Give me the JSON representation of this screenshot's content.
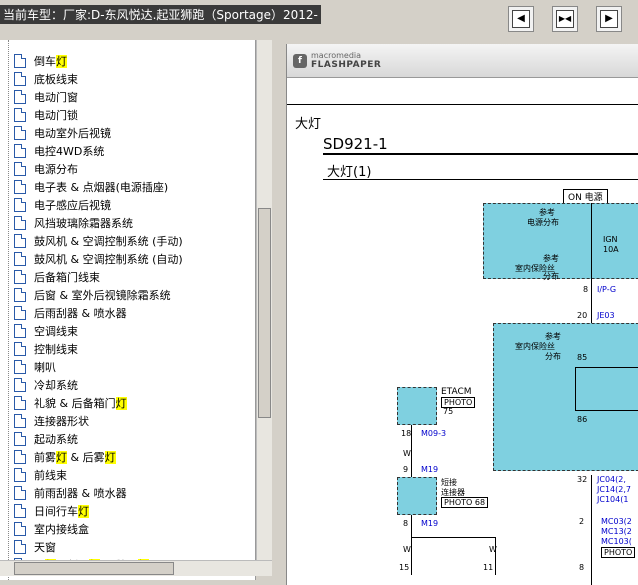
{
  "window": {
    "title": "当前车型：厂家:D-东风悦达.起亚狮跑（Sportage）2012-",
    "buttons": [
      {
        "name": "nav-left-button",
        "glyph": "◀"
      },
      {
        "name": "nav-split-button",
        "glyph": "▶◀"
      },
      {
        "name": "nav-right-button",
        "glyph": "▶"
      }
    ]
  },
  "tree": {
    "items": [
      {
        "pre": "倒车",
        "hl": "灯",
        "post": ""
      },
      {
        "pre": "底板线束",
        "hl": "",
        "post": ""
      },
      {
        "pre": "电动门窗",
        "hl": "",
        "post": ""
      },
      {
        "pre": "电动门锁",
        "hl": "",
        "post": ""
      },
      {
        "pre": "电动室外后视镜",
        "hl": "",
        "post": ""
      },
      {
        "pre": "电控4WD系统",
        "hl": "",
        "post": ""
      },
      {
        "pre": "电源分布",
        "hl": "",
        "post": ""
      },
      {
        "pre": "电子表 & 点烟器(电源插座)",
        "hl": "",
        "post": ""
      },
      {
        "pre": "电子感应后视镜",
        "hl": "",
        "post": ""
      },
      {
        "pre": "风挡玻璃除霜器系统",
        "hl": "",
        "post": ""
      },
      {
        "pre": "鼓风机 & 空调控制系统 (手动)",
        "hl": "",
        "post": ""
      },
      {
        "pre": "鼓风机 & 空调控制系统 (自动)",
        "hl": "",
        "post": ""
      },
      {
        "pre": "后备箱门线束",
        "hl": "",
        "post": ""
      },
      {
        "pre": "后窗 & 室外后视镜除霜系统",
        "hl": "",
        "post": ""
      },
      {
        "pre": "后雨刮器 & 喷水器",
        "hl": "",
        "post": ""
      },
      {
        "pre": "空调线束",
        "hl": "",
        "post": ""
      },
      {
        "pre": "控制线束",
        "hl": "",
        "post": ""
      },
      {
        "pre": "喇叭",
        "hl": "",
        "post": ""
      },
      {
        "pre": "冷却系统",
        "hl": "",
        "post": ""
      },
      {
        "pre": "礼貌 & 后备箱门",
        "hl": "灯",
        "post": ""
      },
      {
        "pre": "连接器形状",
        "hl": "",
        "post": ""
      },
      {
        "pre": "起动系统",
        "hl": "",
        "post": ""
      },
      {
        "pre": "前雾",
        "hl": "灯",
        "post": " & 后雾",
        "hl2": "灯"
      },
      {
        "pre": "前线束",
        "hl": "",
        "post": ""
      },
      {
        "pre": "前雨刮器 & 喷水器",
        "hl": "",
        "post": ""
      },
      {
        "pre": "日间行车",
        "hl": "灯",
        "post": ""
      },
      {
        "pre": "室内接线盒",
        "hl": "",
        "post": ""
      },
      {
        "pre": "天窗",
        "hl": "",
        "post": ""
      },
      {
        "pre": "尾",
        "hl": "灯",
        "post": "，制动",
        "hl2": "灯",
        "post2": " & 牌照",
        "hl3": "灯"
      }
    ]
  },
  "viewer": {
    "logo_top": "macromedia",
    "logo_bottom": "FLASHPAPER",
    "doc_heading": "大灯",
    "section_code": "SD921-1",
    "section_title": "大灯(1)",
    "on_label": "ON 电源",
    "ref1_a": "参考",
    "ref1_b": "电源分布",
    "ign": "IGN",
    "amp": "10A",
    "ref2_a": "参考",
    "ref2_b": "室内保险丝",
    "ref2_c": "分布",
    "pin8": "8",
    "ip_g": "I/P-G",
    "pin20": "20",
    "je03": "JE03",
    "ref3_a": "参考",
    "ref3_b": "室内保险丝",
    "ref3_c": "分布",
    "pin85": "85",
    "pin86": "86",
    "etacm": "ETACM",
    "photo75_a": "PHOTO",
    "photo75_b": "75",
    "pin18": "18",
    "m09_3": "M09-3",
    "w1": "W",
    "pin9": "9",
    "m19a": "M19",
    "short_a": "短接",
    "short_b": "连接器",
    "photo68": "PHOTO 68",
    "pin8b": "8",
    "m19b": "M19",
    "w2": "W",
    "w3": "W",
    "pin15": "15",
    "pin11": "11",
    "pin32": "32",
    "jc04": "JC04(2,",
    "jc14": "JC14(2,7",
    "jc104": "JC104(1",
    "pin2": "2",
    "mc03": "MC03(2",
    "mc13": "MC13(2",
    "mc103": "MC103(",
    "photo_r": "PHOTO",
    "pin_r": "8"
  }
}
